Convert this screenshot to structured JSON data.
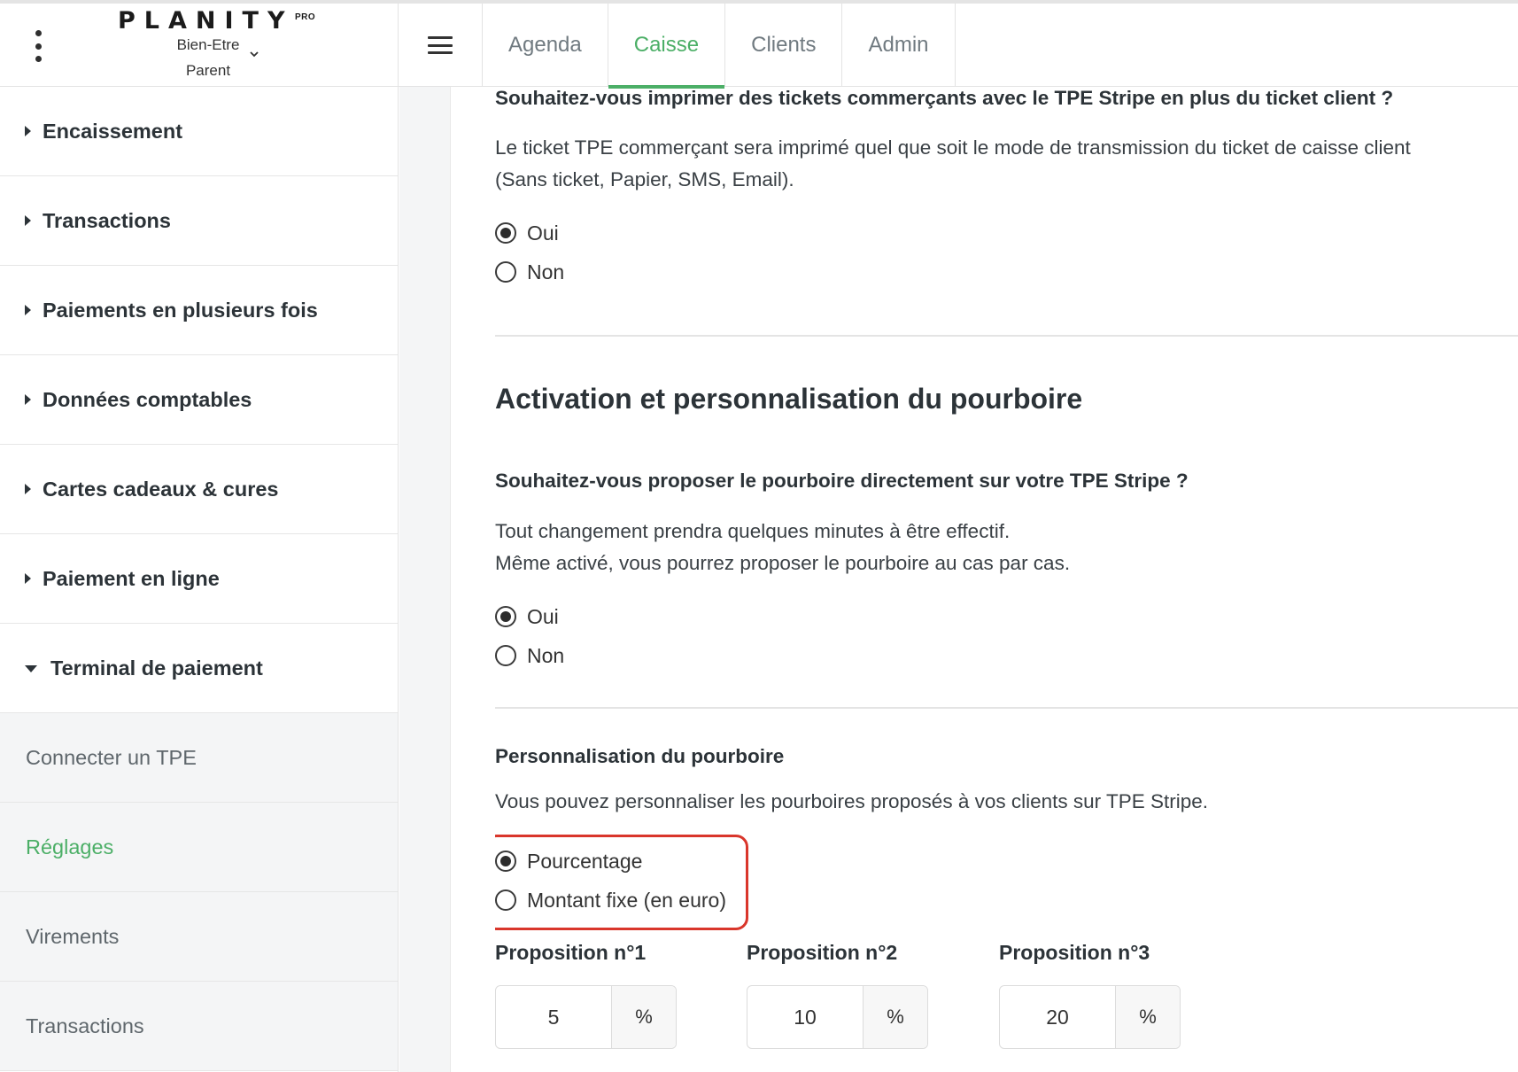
{
  "header": {
    "logo_text": "PLANITY",
    "logo_badge": "PRO",
    "salon_line1": "Bien-Etre",
    "salon_line2": "Parent",
    "tabs": [
      {
        "label": "Agenda"
      },
      {
        "label": "Caisse",
        "active": true
      },
      {
        "label": "Clients"
      },
      {
        "label": "Admin"
      }
    ],
    "accent_color": "#4caf67"
  },
  "sidebar": {
    "sections": [
      {
        "label": "Encaissement"
      },
      {
        "label": "Transactions"
      },
      {
        "label": "Paiements en plusieurs fois"
      },
      {
        "label": "Données comptables"
      },
      {
        "label": "Cartes cadeaux & cures"
      },
      {
        "label": "Paiement en ligne"
      },
      {
        "label": "Terminal de paiement"
      }
    ],
    "subitems": [
      {
        "label": "Connecter un TPE"
      },
      {
        "label": "Réglages"
      },
      {
        "label": "Virements"
      },
      {
        "label": "Transactions"
      }
    ]
  },
  "main": {
    "merchant_ticket": {
      "question": "Souhaitez-vous imprimer des tickets commerçants avec le TPE Stripe en plus du ticket client ?",
      "description_line1": "Le ticket TPE commerçant sera imprimé quel que soit le mode de transmission du ticket de caisse client",
      "description_line2": "(Sans ticket, Papier, SMS, Email).",
      "option_yes": "Oui",
      "option_no": "Non",
      "selected": "Oui"
    },
    "tip_section_title": "Activation et personnalisation du pourboire",
    "tip_activation": {
      "question": "Souhaitez-vous proposer le pourboire directement sur votre TPE Stripe ?",
      "description_line1": "Tout changement prendra quelques minutes à être effectif.",
      "description_line2": "Même activé, vous pourrez proposer le pourboire au cas par cas.",
      "option_yes": "Oui",
      "option_no": "Non",
      "selected": "Oui"
    },
    "tip_customization": {
      "title": "Personnalisation du pourboire",
      "description": "Vous pouvez personnaliser les pourboires proposés à vos clients sur TPE Stripe.",
      "option_percent": "Pourcentage",
      "option_fixed": "Montant fixe (en euro)",
      "selected": "Pourcentage",
      "highlight_color": "#d9362b",
      "proposals": [
        {
          "label": "Proposition n°1",
          "value": "5",
          "unit": "%"
        },
        {
          "label": "Proposition n°2",
          "value": "10",
          "unit": "%"
        },
        {
          "label": "Proposition n°3",
          "value": "20",
          "unit": "%"
        }
      ]
    }
  }
}
